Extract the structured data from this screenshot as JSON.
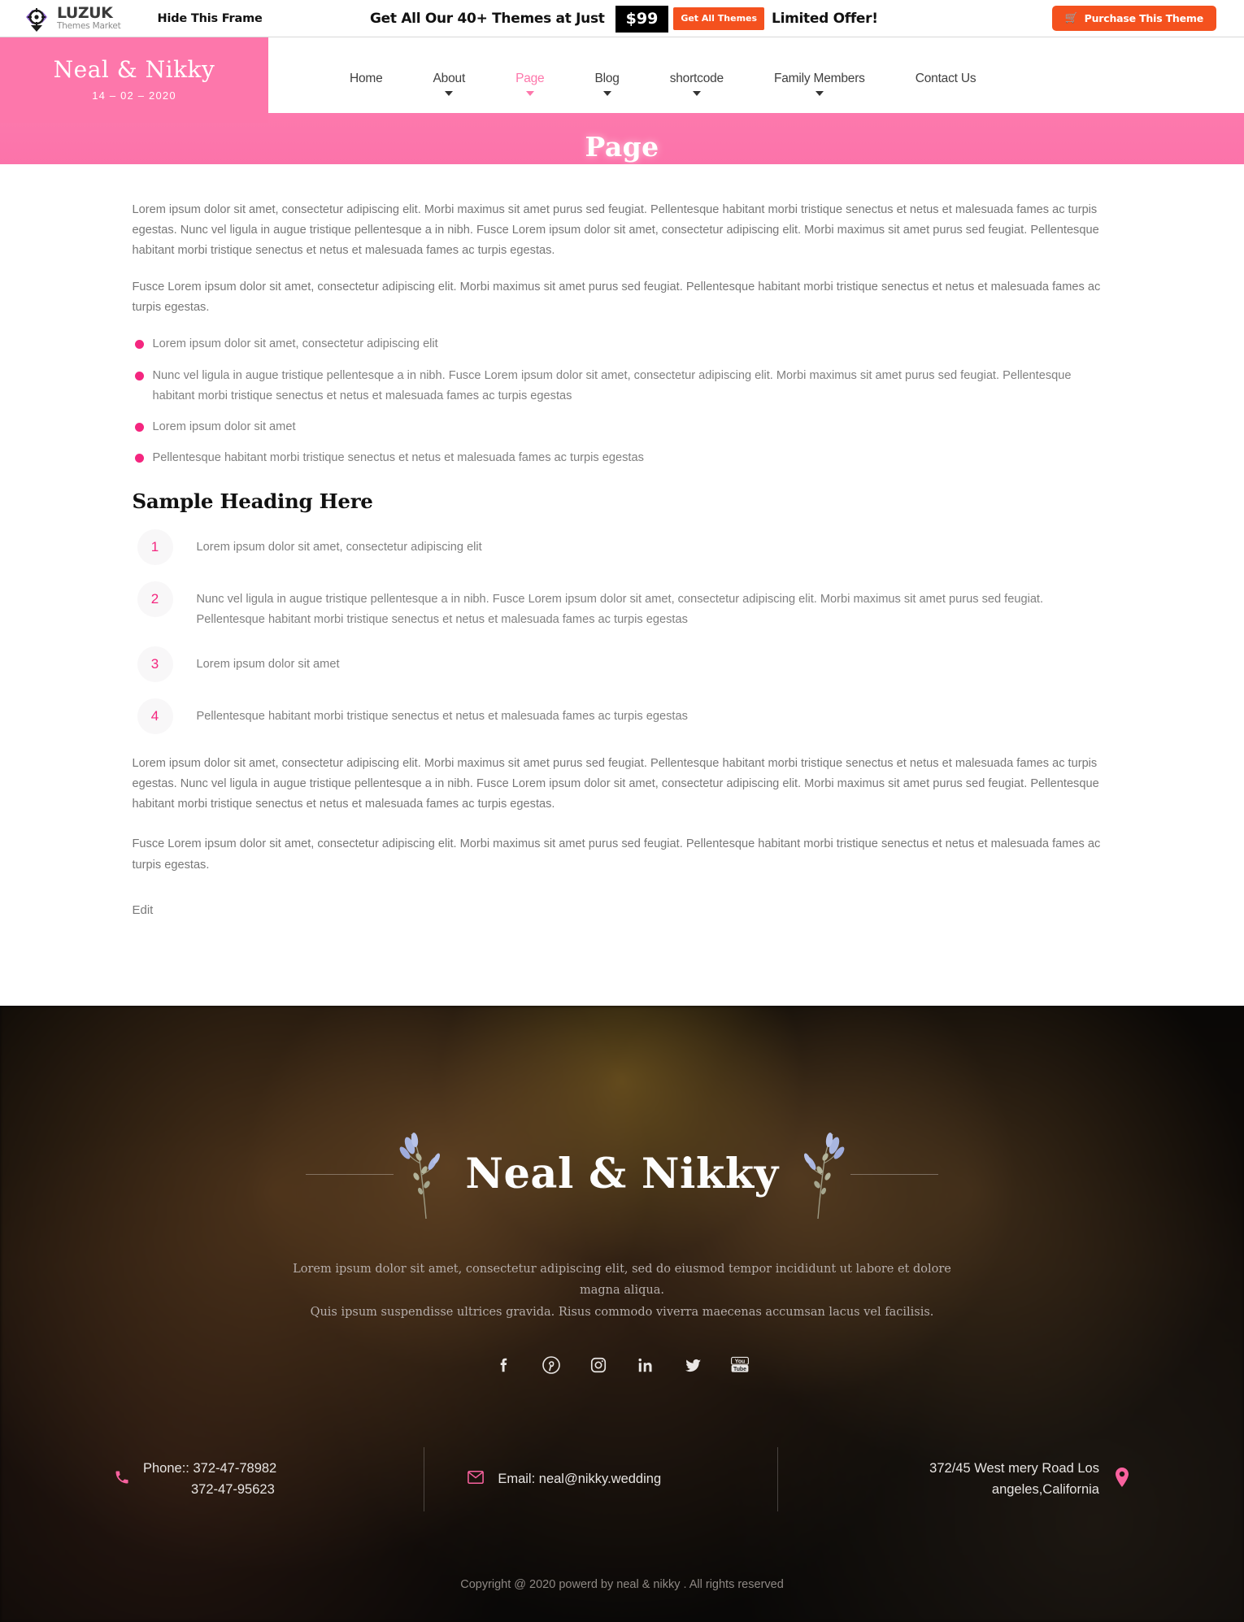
{
  "promo": {
    "logo_name": "LUZUK",
    "logo_sub": "Themes Market",
    "hide_frame": "Hide This Frame",
    "headline": "Get All Our 40+ Themes at Just",
    "price": "$99",
    "cta": "Get All Themes",
    "limited": "Limited Offer!",
    "purchase": "Purchase This Theme"
  },
  "header": {
    "brand_name": "Neal & Nikky",
    "brand_date": "14 – 02 – 2020",
    "nav": [
      {
        "label": "Home",
        "caret": false,
        "active": false
      },
      {
        "label": "About",
        "caret": true,
        "active": false
      },
      {
        "label": "Page",
        "caret": true,
        "active": true
      },
      {
        "label": "Blog",
        "caret": true,
        "active": false
      },
      {
        "label": "shortcode",
        "caret": true,
        "active": false
      },
      {
        "label": "Family Members",
        "caret": true,
        "active": false
      },
      {
        "label": "Contact Us",
        "caret": false,
        "active": false
      }
    ]
  },
  "banner": {
    "title": "Page"
  },
  "content": {
    "para1": "Lorem ipsum dolor sit amet, consectetur adipiscing elit. Morbi maximus sit amet purus sed feugiat. Pellentesque habitant morbi tristique senectus et netus et malesuada fames ac turpis egestas. Nunc vel ligula in augue tristique pellentesque a in nibh. Fusce Lorem ipsum dolor sit amet, consectetur adipiscing elit. Morbi maximus sit amet purus sed feugiat. Pellentesque habitant morbi tristique senectus et netus et malesuada fames ac turpis egestas.",
    "para2": "Fusce Lorem ipsum dolor sit amet, consectetur adipiscing elit. Morbi maximus sit amet purus sed feugiat. Pellentesque habitant morbi tristique senectus et netus et malesuada fames ac turpis egestas.",
    "bullets": [
      "Lorem ipsum dolor sit amet, consectetur adipiscing elit",
      "Nunc vel ligula in augue tristique pellentesque a in nibh. Fusce Lorem ipsum dolor sit amet, consectetur adipiscing elit. Morbi maximus sit amet purus sed feugiat. Pellentesque habitant morbi tristique senectus et netus et malesuada fames ac turpis egestas",
      "Lorem ipsum dolor sit amet",
      "Pellentesque habitant morbi tristique senectus et netus et malesuada fames ac turpis egestas"
    ],
    "heading": "Sample Heading Here",
    "numbered": [
      {
        "num": "1",
        "text": "Lorem ipsum dolor sit amet, consectetur adipiscing elit"
      },
      {
        "num": "2",
        "text": "Nunc vel ligula in augue tristique pellentesque a in nibh. Fusce Lorem ipsum dolor sit amet, consectetur adipiscing elit. Morbi maximus sit amet purus sed feugiat. Pellentesque habitant morbi tristique senectus et netus et malesuada fames ac turpis egestas"
      },
      {
        "num": "3",
        "text": "Lorem ipsum dolor sit amet"
      },
      {
        "num": "4",
        "text": "Pellentesque habitant morbi tristique senectus et netus et malesuada fames ac turpis egestas"
      }
    ],
    "para3": "Lorem ipsum dolor sit amet, consectetur adipiscing elit. Morbi maximus sit amet purus sed feugiat. Pellentesque habitant morbi tristique senectus et netus et malesuada fames ac turpis egestas. Nunc vel ligula in augue tristique pellentesque a in nibh. Fusce Lorem ipsum dolor sit amet, consectetur adipiscing elit. Morbi maximus sit amet purus sed feugiat. Pellentesque habitant morbi tristique senectus et netus et malesuada fames ac turpis egestas.",
    "para4": "Fusce Lorem ipsum dolor sit amet, consectetur adipiscing elit. Morbi maximus sit amet purus sed feugiat. Pellentesque habitant morbi tristique senectus et netus et malesuada fames ac turpis egestas.",
    "edit": "Edit"
  },
  "footer": {
    "brand": "Neal & Nikky",
    "tagline_line1": "Lorem ipsum dolor sit amet, consectetur adipiscing elit, sed do eiusmod tempor incididunt ut labore et dolore magna aliqua.",
    "tagline_line2": "Quis ipsum suspendisse ultrices gravida. Risus commodo viverra maecenas accumsan lacus vel facilisis.",
    "social": [
      "facebook-icon",
      "pinterest-icon",
      "instagram-icon",
      "linkedin-icon",
      "twitter-icon",
      "youtube-icon"
    ],
    "phone_label": "Phone::",
    "phone1": "372-47-78982",
    "phone2": "372-47-95623",
    "email_label": "Email:",
    "email": "neal@nikky.wedding",
    "address": "372/45 West mery Road Los angeles,California",
    "copyright": "Copyright @ 2020 powerd by neal & nikky . All rights reserved"
  },
  "colors": {
    "brand_pink": "#fd77ab",
    "accent_pink": "#f4267f",
    "orange": "#f4511e"
  }
}
